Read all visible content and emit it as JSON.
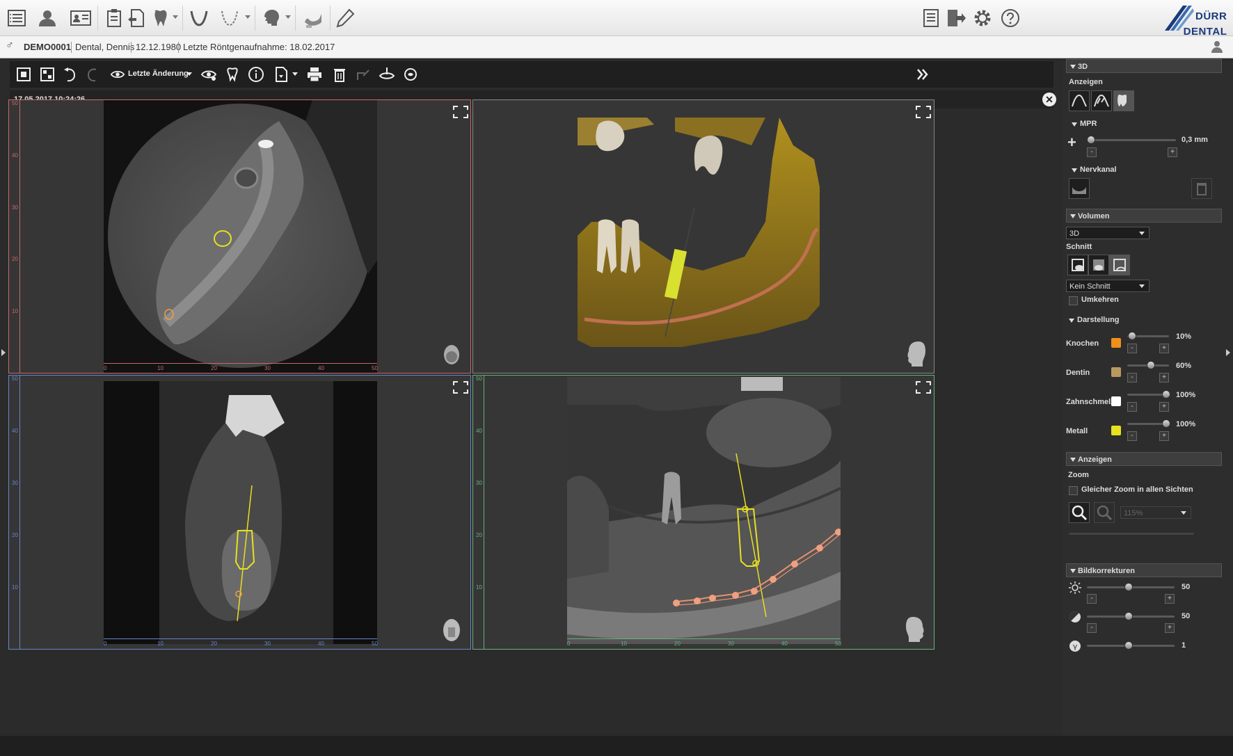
{
  "patient": {
    "id": "DEMO0001",
    "name": "Dental, Dennis",
    "birthdate": "12.12.1980",
    "last_xray": "Letzte Röntgenaufnahme: 18.02.2017"
  },
  "brand": {
    "line1": "DÜRR",
    "line2": "DENTAL",
    "color": "#1a3a7a"
  },
  "viewer_toolbar": {
    "view_mode_label": "Letzte Änderung"
  },
  "image": {
    "timestamp": "17.05.2017 10:24:26"
  },
  "viewports": {
    "top_left": {
      "axis": "red",
      "color": "#c86a6a",
      "v_ticks": [
        "50",
        "40",
        "30",
        "20",
        "10"
      ],
      "h_ticks": [
        "0",
        "10",
        "20",
        "30",
        "40",
        "50"
      ]
    },
    "bottom_left": {
      "axis": "blue",
      "color": "#6a86c8",
      "v_ticks": [
        "50",
        "40",
        "30",
        "20",
        "10"
      ],
      "h_ticks": [
        "0",
        "10",
        "20",
        "30",
        "40",
        "50"
      ]
    },
    "bottom_right": {
      "axis": "green",
      "color": "#6ab07a",
      "v_ticks": [
        "50",
        "40",
        "30",
        "20",
        "10"
      ],
      "h_ticks": [
        "0",
        "10",
        "20",
        "30",
        "40",
        "50"
      ]
    }
  },
  "panel": {
    "section_3d": "3D",
    "anzeigen": "Anzeigen",
    "mpr": "MPR",
    "mpr_value": "0,3 mm",
    "nervkanal": "Nervkanal",
    "volumen": "Volumen",
    "volumen_select": "3D",
    "schnitt": "Schnitt",
    "schnitt_select": "Kein Schnitt",
    "umkehren": "Umkehren",
    "darstellung": "Darstellung",
    "materials": [
      {
        "label": "Knochen",
        "value": "10%",
        "color": "#f0901c",
        "level": 10
      },
      {
        "label": "Dentin",
        "value": "60%",
        "color": "#b89a60",
        "level": 60
      },
      {
        "label": "Zahnschmelz",
        "value": "100%",
        "color": "#ffffff",
        "level": 100
      },
      {
        "label": "Metall",
        "value": "100%",
        "color": "#e8e020",
        "level": 100
      }
    ],
    "anzeigen2": "Anzeigen",
    "zoom": "Zoom",
    "same_zoom": "Gleicher Zoom in allen Sichten",
    "zoom_value": "115%",
    "bildkorrekturen": "Bildkorrekturen",
    "corrections": [
      {
        "value": "50",
        "level": 50
      },
      {
        "value": "50",
        "level": 50
      },
      {
        "value": "1",
        "level": 50
      }
    ]
  }
}
